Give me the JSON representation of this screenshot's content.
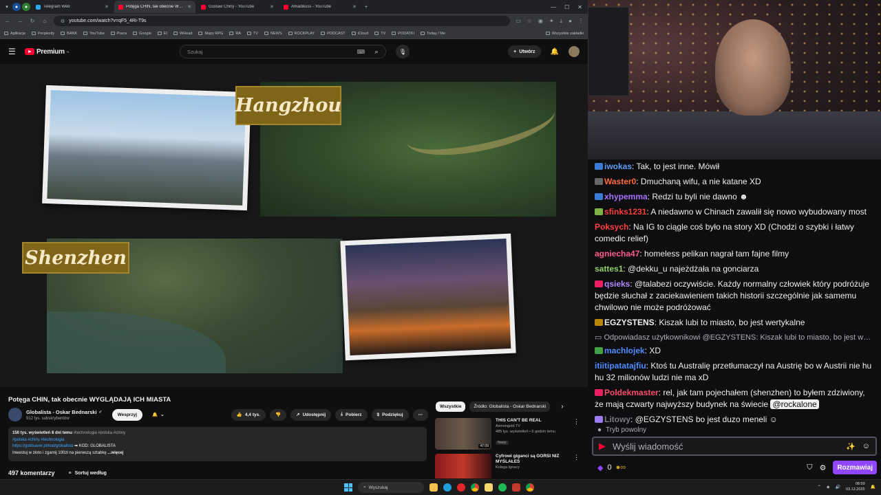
{
  "browser": {
    "tabs": [
      {
        "label": "Telegram Web",
        "color": "#2aabee"
      },
      {
        "label": "Potęga CHIN, tak obecnie WYG",
        "color": "#ff0033",
        "active": true
      },
      {
        "label": "Gustaw Chiny - YouTube",
        "color": "#ff0033"
      },
      {
        "label": "Arkadikuss - YouTube",
        "color": "#ff0033"
      }
    ],
    "url": "youtube.com/watch?v=qF5_4Ri-T9s",
    "bookmarks": [
      "Aplikacje",
      "Perplexity",
      "BANK",
      "YouTube",
      "Praca",
      "Google",
      "EI",
      "WHead",
      "Mapy RPG",
      "RA",
      "TV",
      "NEWS",
      "ROCKPLAY",
      "PODCAST",
      "iCloud",
      "TV",
      "PODATKI",
      "Today / Me"
    ],
    "bookmarks_all": "Wszystkie zakładki"
  },
  "youtube": {
    "logo": "Premium",
    "logo_sup": "PL",
    "search_placeholder": "Szukaj",
    "create_label": "Utwórz",
    "video": {
      "label_a": "Hangzhou",
      "label_b": "Shenzhen"
    },
    "title": "Potęga CHIN, tak obecnie WYGLĄDAJĄ ICH MIASTA",
    "channel_name": "Globalista - Oskar Bednarski",
    "channel_subs": "912 tys. subskrybentów",
    "support_label": "Wesprzyj",
    "likes": "4,4 tys.",
    "share_label": "Udostępnij",
    "download_label": "Pobierz",
    "thanks_label": "Podziękuj",
    "desc_stats": "150 tys. wyświetleń  8 dni temu",
    "desc_stats_tags": "#technologia #polska #chiny",
    "desc_tags": "#polska #chiny #technologia",
    "desc_link": "https://goldsaver.pl/kod/globalista",
    "desc_code": "KOD: GLOBALISTA",
    "desc_text": "Inwestuj w złoto i zgarnij 100zł na pierwszą sztabkę",
    "desc_more": "...więcej",
    "comments_count": "497 komentarzy",
    "sort_label": "Sortuj według",
    "chips": [
      "Wszystkie",
      "Źródło: Globalista - Oskar Bednarski"
    ],
    "recommendations": [
      {
        "title": "THIS CAN'T BE REAL",
        "channel": "Asmongold TV",
        "meta": "485 tys. wyświetleń • 6 godzin temu",
        "badge": "Nowy",
        "duration": "47:09"
      },
      {
        "title": "Cyfrowi giganci są GORSI NIŻ MYŚLAŁEŚ",
        "channel": "Kolega Ignacy",
        "meta": "",
        "badge": "",
        "duration": ""
      }
    ]
  },
  "chat": {
    "messages": [
      {
        "user": "iwokas",
        "color": "#5b9cf6",
        "text": "Tak, to jest inne. Mówił"
      },
      {
        "user": "Waster0",
        "color": "#ff6b3d",
        "text": "Dmuchaną wifu, a nie katane XD"
      },
      {
        "user": "xhypemma",
        "color": "#a970ff",
        "text": "Redzi tu byli nie dawno"
      },
      {
        "user": "sfinks1231",
        "color": "#ff3b3b",
        "text": "A niedawno w Chinach zawalił się nowo wybudowany most"
      },
      {
        "user": "Poksych",
        "color": "#ff4040",
        "text": "Na IG to ciągle coś było na story XD (Chodzi o szybki i łatwy comedic relief)"
      },
      {
        "user": "agniecha47",
        "color": "#ff5c8a",
        "text": "homeless pelikan nagrał tam fajne filmy"
      },
      {
        "user": "sattes1",
        "color": "#8fd16a",
        "text": "@dekku_u najeżdżała na gonciarza"
      },
      {
        "user": "qsieks",
        "color": "#b089ff",
        "text": "@talabezi oczywiście. Każdy normalny człowiek który podróżuje będzie słuchał z zaciekawieniem takich historii szczególnie jak samemu chwilowo nie może podróżować"
      },
      {
        "user": "EGZYSTENS",
        "color": "#efeff1",
        "text": "Kiszak lubi to miasto, bo jest wertykalne"
      },
      {
        "reply": "Odpowiadasz użytkownikowi @EGZYSTENS: Kiszak lubi to miasto, bo jest wert..."
      },
      {
        "user": "machlojek",
        "color": "#4f8cff",
        "text": "XD"
      },
      {
        "user": "itiitipatatajfiu",
        "color": "#4f8cff",
        "text": "Ktoś tu Australię przetłumaczył na Austrię bo w Austrii nie hu hu 32 milionów ludzi nie ma xD"
      },
      {
        "user": "Poldekmaster",
        "color": "#ff4d6a",
        "text": "rel, jak tam pojechałem (shenzhen) to byłem zdziwiony, że mają czwarty najwyższy budynek na świecie",
        "mention": "@rockalone"
      },
      {
        "user": "Litowy",
        "color": "#7a7a85",
        "text": "@EGZYSTENS bo jest duzo meneli"
      }
    ],
    "slow_mode": "Tryb powolny",
    "input_placeholder": "Wyślij wiadomość",
    "points": "0",
    "talk_label": "Rozmawiaj"
  },
  "taskbar": {
    "search": "Wyszukaj",
    "time": "08:59",
    "date": "03.12.2025"
  }
}
